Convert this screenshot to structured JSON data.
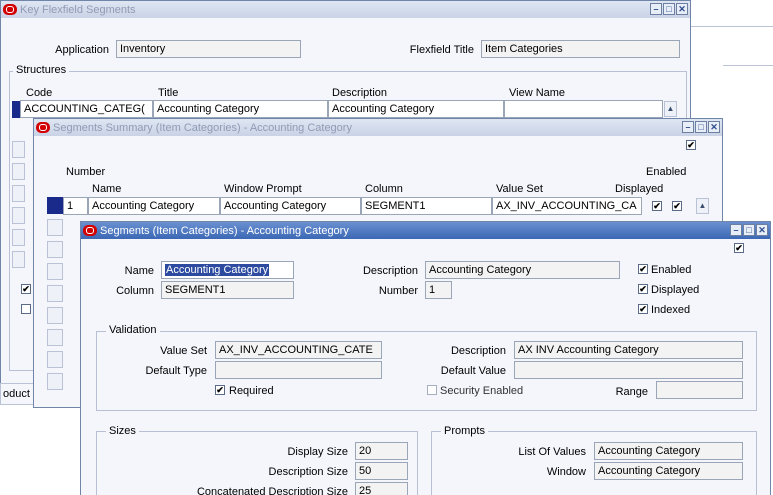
{
  "kf": {
    "title": "Key Flexfield Segments",
    "app_label": "Application",
    "app_value": "Inventory",
    "flex_label": "Flexfield Title",
    "flex_value": "Item Categories",
    "structures_label": "Structures",
    "headers": [
      "Code",
      "Title",
      "Description",
      "View Name"
    ],
    "row": {
      "code": "ACCOUNTING_CATEG(",
      "title": "Accounting Category",
      "description": "Accounting Category",
      "view_name": ""
    },
    "partial_product": "oduct"
  },
  "ss": {
    "title": "Segments Summary (Item Categories) - Accounting Category",
    "headers": {
      "number": "Number",
      "name": "Name",
      "prompt": "Window Prompt",
      "column": "Column",
      "value_set": "Value Set",
      "enabled": "Enabled",
      "displayed": "Displayed"
    },
    "row": {
      "number": "1",
      "name": "Accounting Category",
      "prompt": "Accounting Category",
      "column": "SEGMENT1",
      "value_set": "AX_INV_ACCOUNTING_CA"
    }
  },
  "sg": {
    "title": "Segments (Item Categories) - Accounting Category",
    "name_label": "Name",
    "name_value": "Accounting Category",
    "column_label": "Column",
    "column_value": "SEGMENT1",
    "desc_label": "Description",
    "desc_value": "Accounting Category",
    "number_label": "Number",
    "number_value": "1",
    "enabled_label": "Enabled",
    "displayed_label": "Displayed",
    "indexed_label": "Indexed",
    "validation": {
      "title": "Validation",
      "value_set_label": "Value Set",
      "value_set_value": "AX_INV_ACCOUNTING_CATE",
      "vs_desc_label": "Description",
      "vs_desc_value": "AX INV Accounting Category",
      "default_type_label": "Default Type",
      "default_value_label": "Default Value",
      "required_label": "Required",
      "security_label": "Security Enabled",
      "range_label": "Range"
    },
    "sizes": {
      "title": "Sizes",
      "display_label": "Display Size",
      "display_value": "20",
      "desc_size_label": "Description Size",
      "desc_size_value": "50",
      "concat_label": "Concatenated Description Size",
      "concat_value": "25"
    },
    "prompts": {
      "title": "Prompts",
      "lov_label": "List Of Values",
      "lov_value": "Accounting Category",
      "window_label": "Window",
      "window_value": "Accounting Category"
    }
  },
  "checkmark": "✔",
  "colors": {
    "active_title": "#3b67b5",
    "inactive_title": "#c9d3e6",
    "current_record": "#1a2a8a",
    "oracle_red": "#d20000"
  }
}
